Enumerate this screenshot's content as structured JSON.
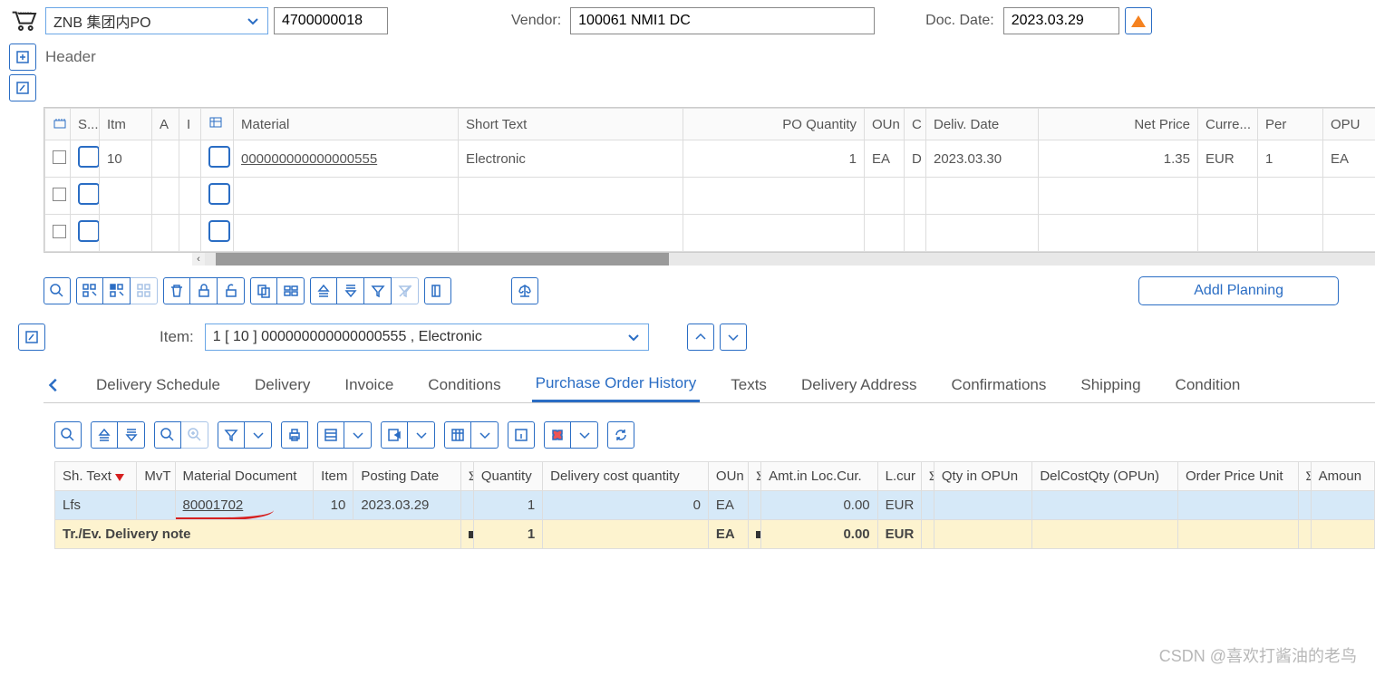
{
  "header": {
    "order_type": "ZNB 集团内PO",
    "po_number": "4700000018",
    "vendor_label": "Vendor:",
    "vendor_value": "100061 NMI1 DC",
    "doc_date_label": "Doc. Date:",
    "doc_date_value": "2023.03.29",
    "header_text": "Header"
  },
  "items": {
    "cols": {
      "s": "S...",
      "itm": "Itm",
      "a": "A",
      "i": "I",
      "material": "Material",
      "short": "Short Text",
      "qty": "PO Quantity",
      "oun": "OUn",
      "c": "C",
      "deliv": "Deliv. Date",
      "net": "Net Price",
      "curr": "Curre...",
      "per": "Per",
      "opu": "OPU"
    },
    "rows": [
      {
        "itm": "10",
        "material": "000000000000000555",
        "short": "Electronic",
        "qty": "1",
        "oun": "EA",
        "c": "D",
        "deliv": "2023.03.30",
        "net": "1.35",
        "curr": "EUR",
        "per": "1",
        "opu": "EA"
      },
      {
        "itm": "",
        "material": "",
        "short": "",
        "qty": "",
        "oun": "",
        "c": "",
        "deliv": "",
        "net": "",
        "curr": "",
        "per": "",
        "opu": ""
      },
      {
        "itm": "",
        "material": "",
        "short": "",
        "qty": "",
        "oun": "",
        "c": "",
        "deliv": "",
        "net": "",
        "curr": "",
        "per": "",
        "opu": ""
      }
    ]
  },
  "addl_btn": "Addl Planning",
  "item_detail": {
    "label": "Item:",
    "value": "1 [ 10 ] 000000000000000555 , Electronic"
  },
  "tabs": [
    "Delivery Schedule",
    "Delivery",
    "Invoice",
    "Conditions",
    "Purchase Order History",
    "Texts",
    "Delivery Address",
    "Confirmations",
    "Shipping",
    "Condition"
  ],
  "active_tab": 4,
  "hist": {
    "cols": {
      "sh": "Sh. Text",
      "mvt": "MvT",
      "matdoc": "Material Document",
      "item": "Item",
      "posting": "Posting Date",
      "qty": "Quantity",
      "dcq": "Delivery cost quantity",
      "oun": "OUn",
      "amt": "Amt.in Loc.Cur.",
      "lcur": "L.cur",
      "qopun": "Qty in OPUn",
      "delcost": "DelCostQty (OPUn)",
      "opunit": "Order Price Unit",
      "amount": "Amoun"
    },
    "row": {
      "sh": "Lfs",
      "mvt": "",
      "matdoc": "80001702",
      "item": "10",
      "posting": "2023.03.29",
      "qty": "1",
      "dcq": "0",
      "oun": "EA",
      "amt": "0.00",
      "lcur": "EUR",
      "qopun": "",
      "delcost": "",
      "opunit": "",
      "amount": ""
    },
    "sum": {
      "sh": "Tr./Ev. Delivery note",
      "qty": "1",
      "oun": "EA",
      "amt": "0.00",
      "lcur": "EUR"
    }
  },
  "watermark": "CSDN @喜欢打酱油的老鸟"
}
